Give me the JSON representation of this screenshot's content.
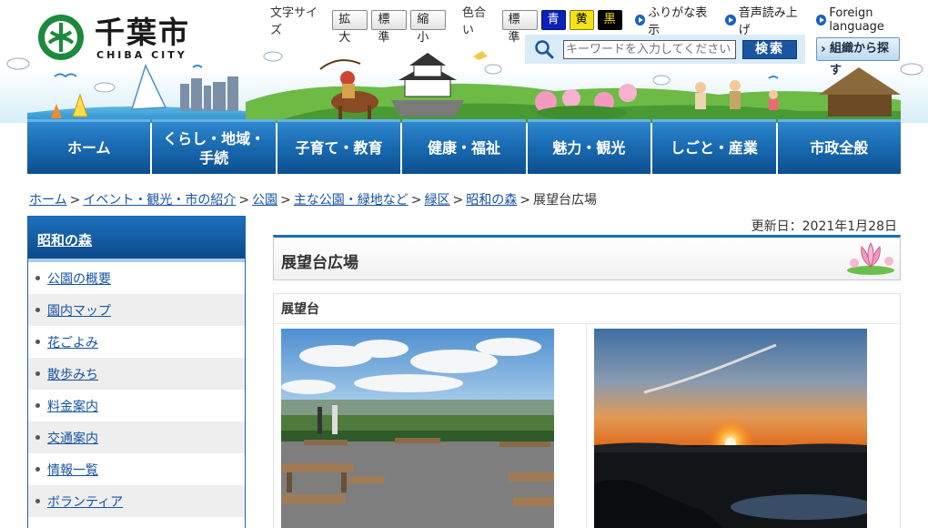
{
  "header": {
    "logo_name": "千葉市",
    "logo_sub": "CHIBA CITY",
    "tools": {
      "text_size_label": "文字サイズ",
      "text_size_buttons": [
        "拡大",
        "標準",
        "縮小"
      ],
      "color_label": "色合い",
      "color_buttons": [
        "標準",
        "青",
        "黄",
        "黒"
      ],
      "furigana": "ふりがな表示",
      "read_aloud": "音声読み上げ",
      "foreign_language": "Foreign language"
    },
    "search": {
      "placeholder": "キーワードを入力してください",
      "button": "検索"
    },
    "org_search": "組織から探す"
  },
  "gnav": [
    "ホーム",
    "くらし・地域・\n手続",
    "子育て・教育",
    "健康・福祉",
    "魅力・観光",
    "しごと・産業",
    "市政全般"
  ],
  "breadcrumb": [
    "ホーム",
    "イベント・観光・市の紹介",
    "公園",
    "主な公園・緑地など",
    "緑区",
    "昭和の森",
    "展望台広場"
  ],
  "sidebar": {
    "title": "昭和の森",
    "items": [
      "公園の概要",
      "園内マップ",
      "花ごよみ",
      "散歩みち",
      "料金案内",
      "交通案内",
      "情報一覧",
      "ボランティア"
    ]
  },
  "main": {
    "updated": "更新日：2021年1月28日",
    "title": "展望台広場",
    "section_title": "展望台"
  },
  "colors": {
    "nav_blue": "#1a6cb3",
    "link": "#1653a3",
    "search_bg": "#d9ecf7"
  }
}
